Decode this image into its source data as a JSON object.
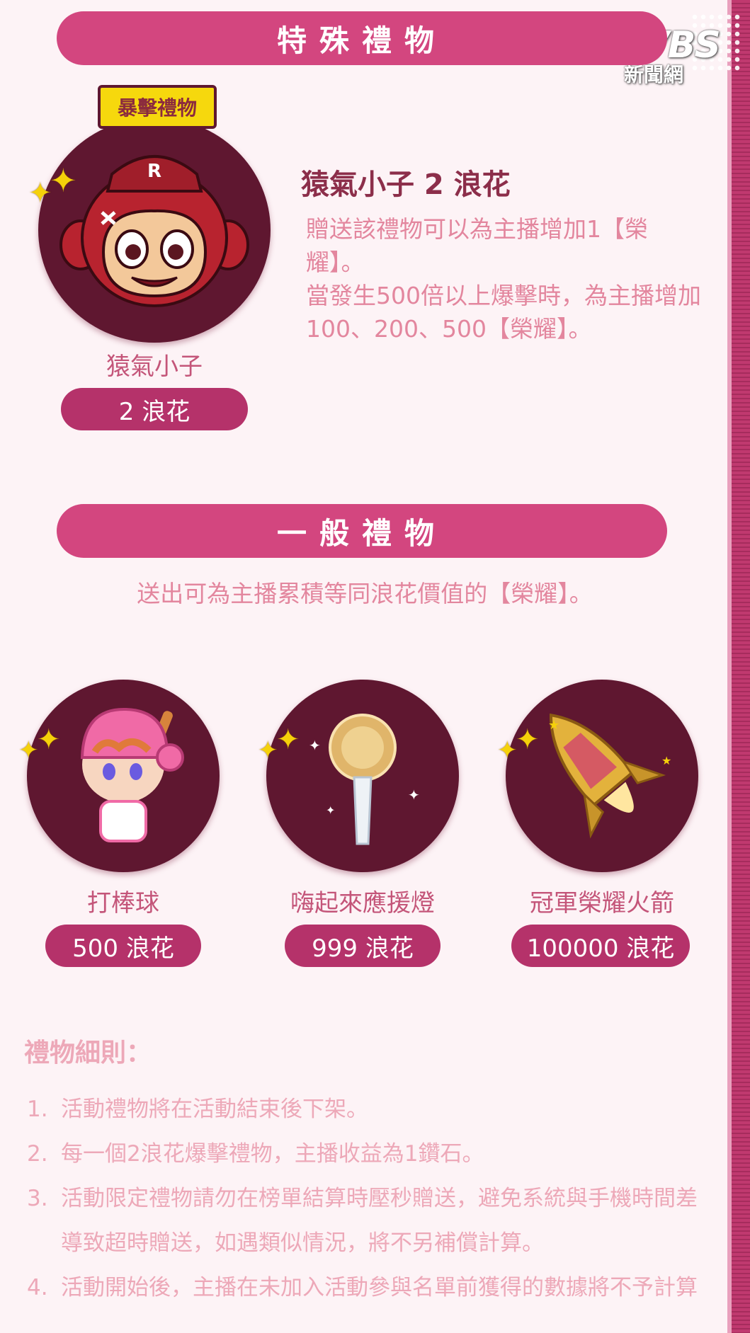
{
  "logo": {
    "brand": "TVBS",
    "subtitle": "新聞網"
  },
  "special": {
    "section_title": "特殊禮物",
    "tag": "暴擊禮物",
    "gift_name": "猿氣小子",
    "price": "2 浪花",
    "desc_title": "猿氣小子 2 浪花",
    "desc_line1": "贈送該禮物可以為主播增加1【榮耀】。",
    "desc_line2": "當發生500倍以上爆擊時，為主播增加100、200、500【榮耀】。",
    "colors": {
      "bar": "#d3467f",
      "circle": "#5f1730",
      "tag": "#f6d80d"
    },
    "icon": "monkey-mascot-icon"
  },
  "general": {
    "section_title": "一般禮物",
    "description": "送出可為主播累積等同浪花價值的【榮耀】。",
    "gifts": [
      {
        "name": "打棒球",
        "price": "500 浪花",
        "icon": "baseball-girl-icon"
      },
      {
        "name": "嗨起來應援燈",
        "price": "999 浪花",
        "icon": "cheer-light-icon"
      },
      {
        "name": "冠軍榮耀火箭",
        "price": "100000 浪花",
        "icon": "rocket-icon"
      }
    ]
  },
  "rules": {
    "title": "禮物細則：",
    "items": [
      {
        "num": "1.",
        "text": "活動禮物將在活動結束後下架。"
      },
      {
        "num": "2.",
        "text": "每一個2浪花爆擊禮物，主播收益為1鑽石。"
      },
      {
        "num": "3.",
        "text": "活動限定禮物請勿在榜單結算時壓秒贈送，避免系統與手機時間差導致超時贈送，如遇類似情況，將不另補償計算。"
      },
      {
        "num": "4.",
        "text": "活動開始後，主播在未加入活動參與名單前獲得的數據將不予計算"
      }
    ]
  }
}
